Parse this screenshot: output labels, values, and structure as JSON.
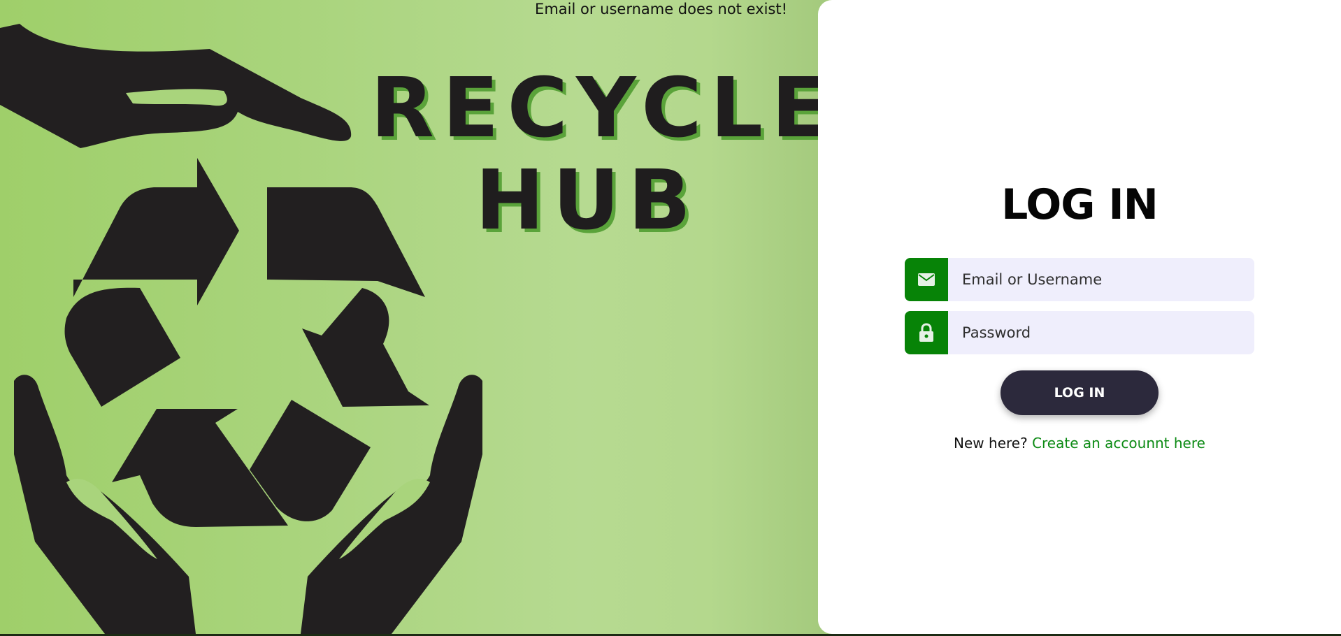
{
  "hero": {
    "error_message": "Email or username does not exist!",
    "brand_line1": "RECYCLE",
    "brand_line2": "HUB"
  },
  "login": {
    "title": "LOG IN",
    "email_placeholder": "Email or Username",
    "password_placeholder": "Password",
    "button_label": "LOG IN",
    "signup_prompt": "New here?",
    "signup_link": "Create an accounnt here"
  },
  "icons": {
    "email": "envelope-icon",
    "password": "lock-icon",
    "hero": "recycle-hands-icon"
  },
  "colors": {
    "accent_green": "#078307",
    "button_dark": "#2c293c",
    "link_green": "#0b8a13",
    "input_bg": "#efeefc",
    "hero_green": "#a9d47c"
  }
}
